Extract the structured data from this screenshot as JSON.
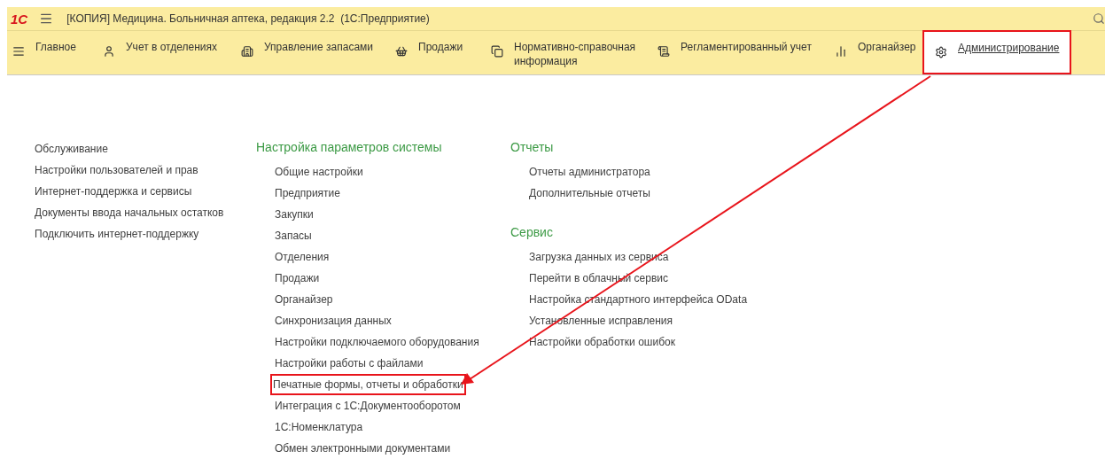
{
  "app": {
    "logo": "1С",
    "title": "[КОПИЯ] Медицина. Больничная аптека, редакция 2.2  (1С:Предприятие)"
  },
  "sections": [
    {
      "label": "Главное",
      "selected": false,
      "highlighted": false
    },
    {
      "label": "Учет в отделениях",
      "selected": false,
      "highlighted": false
    },
    {
      "label": "Управление запасами",
      "selected": false,
      "highlighted": false
    },
    {
      "label": "Продажи",
      "selected": false,
      "highlighted": false
    },
    {
      "label": "Нормативно-справочная информация",
      "selected": false,
      "highlighted": false
    },
    {
      "label": "Регламентированный учет",
      "selected": false,
      "highlighted": false
    },
    {
      "label": "Органайзер",
      "selected": false,
      "highlighted": false
    },
    {
      "label": "Администрирование",
      "selected": true,
      "highlighted": true
    }
  ],
  "left_links": [
    "Обслуживание",
    "Настройки пользователей и прав",
    "Интернет-поддержка и сервисы",
    "Документы ввода начальных остатков",
    "Подключить интернет-поддержку"
  ],
  "columns": [
    {
      "groups": [
        {
          "title": "Настройка параметров системы",
          "items": [
            {
              "label": "Общие настройки",
              "highlighted": false
            },
            {
              "label": "Предприятие",
              "highlighted": false
            },
            {
              "label": "Закупки",
              "highlighted": false
            },
            {
              "label": "Запасы",
              "highlighted": false
            },
            {
              "label": "Отделения",
              "highlighted": false
            },
            {
              "label": "Продажи",
              "highlighted": false
            },
            {
              "label": "Органайзер",
              "highlighted": false
            },
            {
              "label": "Синхронизация данных",
              "highlighted": false
            },
            {
              "label": "Настройки подключаемого оборудования",
              "highlighted": false
            },
            {
              "label": "Настройки работы с файлами",
              "highlighted": false
            },
            {
              "label": "Печатные формы, отчеты и обработки",
              "highlighted": true
            },
            {
              "label": "Интеграция с 1С:Документооборотом",
              "highlighted": false
            },
            {
              "label": "1С:Номенклатура",
              "highlighted": false
            },
            {
              "label": "Обмен электронными документами",
              "highlighted": false
            }
          ]
        }
      ]
    },
    {
      "groups": [
        {
          "title": "Отчеты",
          "items": [
            {
              "label": "Отчеты администратора",
              "highlighted": false
            },
            {
              "label": "Дополнительные отчеты",
              "highlighted": false
            }
          ]
        },
        {
          "title": "Сервис",
          "items": [
            {
              "label": "Загрузка данных из сервиса",
              "highlighted": false
            },
            {
              "label": "Перейти в облачный сервис",
              "highlighted": false
            },
            {
              "label": "Настройка стандартного интерфейса OData",
              "highlighted": false
            },
            {
              "label": "Установленные исправления",
              "highlighted": false
            },
            {
              "label": "Настройки обработки ошибок",
              "highlighted": false
            }
          ]
        }
      ]
    }
  ]
}
